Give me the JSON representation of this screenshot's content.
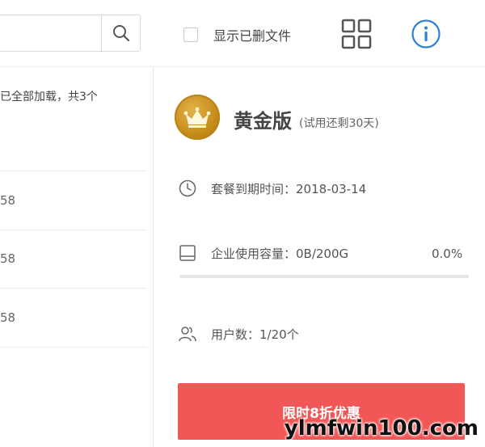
{
  "toolbar": {
    "search_placeholder": "",
    "show_deleted_label": "显示已删文件",
    "show_deleted_checked": false,
    "search_icon": "search-icon",
    "grid_icon": "grid-icon",
    "info_icon": "info-icon",
    "accent_color": "#2f7fd8"
  },
  "file_list": {
    "load_status": "已全部加载，共3个",
    "rows": [
      {
        "value": "58"
      },
      {
        "value": "58"
      },
      {
        "value": "58"
      }
    ]
  },
  "plan": {
    "badge_icon": "crown-icon",
    "name": "黄金版",
    "trial": "(试用还剩30天)",
    "expiry": "套餐到期时间：2018-03-14",
    "storage": "企业使用容量：0B/200G",
    "storage_percent_label": "0.0%",
    "storage_fraction": 0.0,
    "users": "用户数：1/20个",
    "promo_button": "限时8折优惠",
    "promo_color": "#f25757"
  },
  "watermark": "ylmfwin100.com"
}
